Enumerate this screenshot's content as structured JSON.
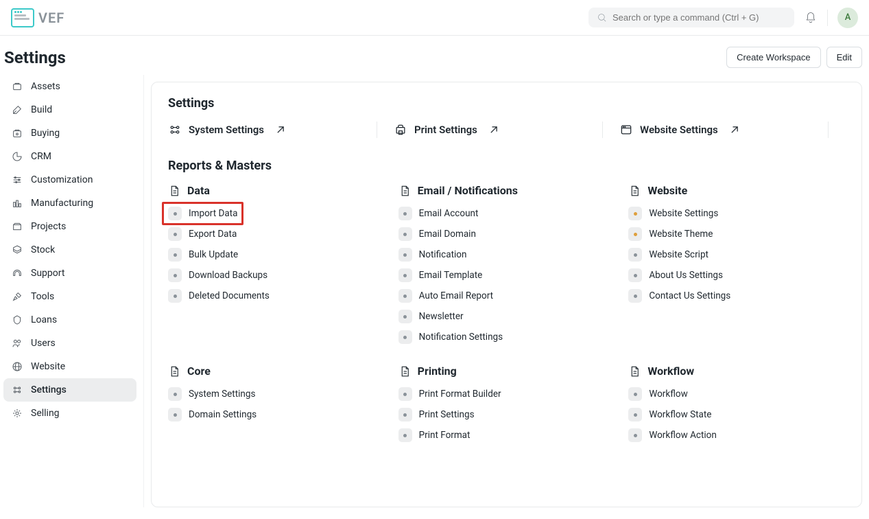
{
  "navbar": {
    "brand": "VEF",
    "search_placeholder": "Search or type a command (Ctrl + G)",
    "user_initial": "A"
  },
  "page": {
    "title": "Settings",
    "actions": {
      "create_workspace": "Create Workspace",
      "edit": "Edit"
    }
  },
  "sidebar": {
    "items": [
      {
        "label": "Assets"
      },
      {
        "label": "Build"
      },
      {
        "label": "Buying"
      },
      {
        "label": "CRM"
      },
      {
        "label": "Customization"
      },
      {
        "label": "Manufacturing"
      },
      {
        "label": "Projects"
      },
      {
        "label": "Stock"
      },
      {
        "label": "Support"
      },
      {
        "label": "Tools"
      },
      {
        "label": "Loans"
      },
      {
        "label": "Users"
      },
      {
        "label": "Website"
      },
      {
        "label": "Settings",
        "active": true
      },
      {
        "label": "Selling"
      }
    ]
  },
  "content": {
    "settings_heading": "Settings",
    "shortcuts": [
      {
        "label": "System Settings"
      },
      {
        "label": "Print Settings"
      },
      {
        "label": "Website Settings"
      }
    ],
    "reports_heading": "Reports & Masters",
    "groups_row1": [
      {
        "title": "Data",
        "links": [
          {
            "label": "Import Data",
            "highlighted": true
          },
          {
            "label": "Export Data"
          },
          {
            "label": "Bulk Update"
          },
          {
            "label": "Download Backups"
          },
          {
            "label": "Deleted Documents"
          }
        ]
      },
      {
        "title": "Email / Notifications",
        "links": [
          {
            "label": "Email Account"
          },
          {
            "label": "Email Domain"
          },
          {
            "label": "Notification"
          },
          {
            "label": "Email Template"
          },
          {
            "label": "Auto Email Report"
          },
          {
            "label": "Newsletter"
          },
          {
            "label": "Notification Settings"
          }
        ]
      },
      {
        "title": "Website",
        "links": [
          {
            "label": "Website Settings",
            "tone": "yellow"
          },
          {
            "label": "Website Theme",
            "tone": "yellow"
          },
          {
            "label": "Website Script"
          },
          {
            "label": "About Us Settings"
          },
          {
            "label": "Contact Us Settings"
          }
        ]
      }
    ],
    "groups_row2": [
      {
        "title": "Core",
        "links": [
          {
            "label": "System Settings"
          },
          {
            "label": "Domain Settings"
          }
        ]
      },
      {
        "title": "Printing",
        "links": [
          {
            "label": "Print Format Builder"
          },
          {
            "label": "Print Settings"
          },
          {
            "label": "Print Format"
          }
        ]
      },
      {
        "title": "Workflow",
        "links": [
          {
            "label": "Workflow"
          },
          {
            "label": "Workflow State"
          },
          {
            "label": "Workflow Action"
          }
        ]
      }
    ]
  }
}
